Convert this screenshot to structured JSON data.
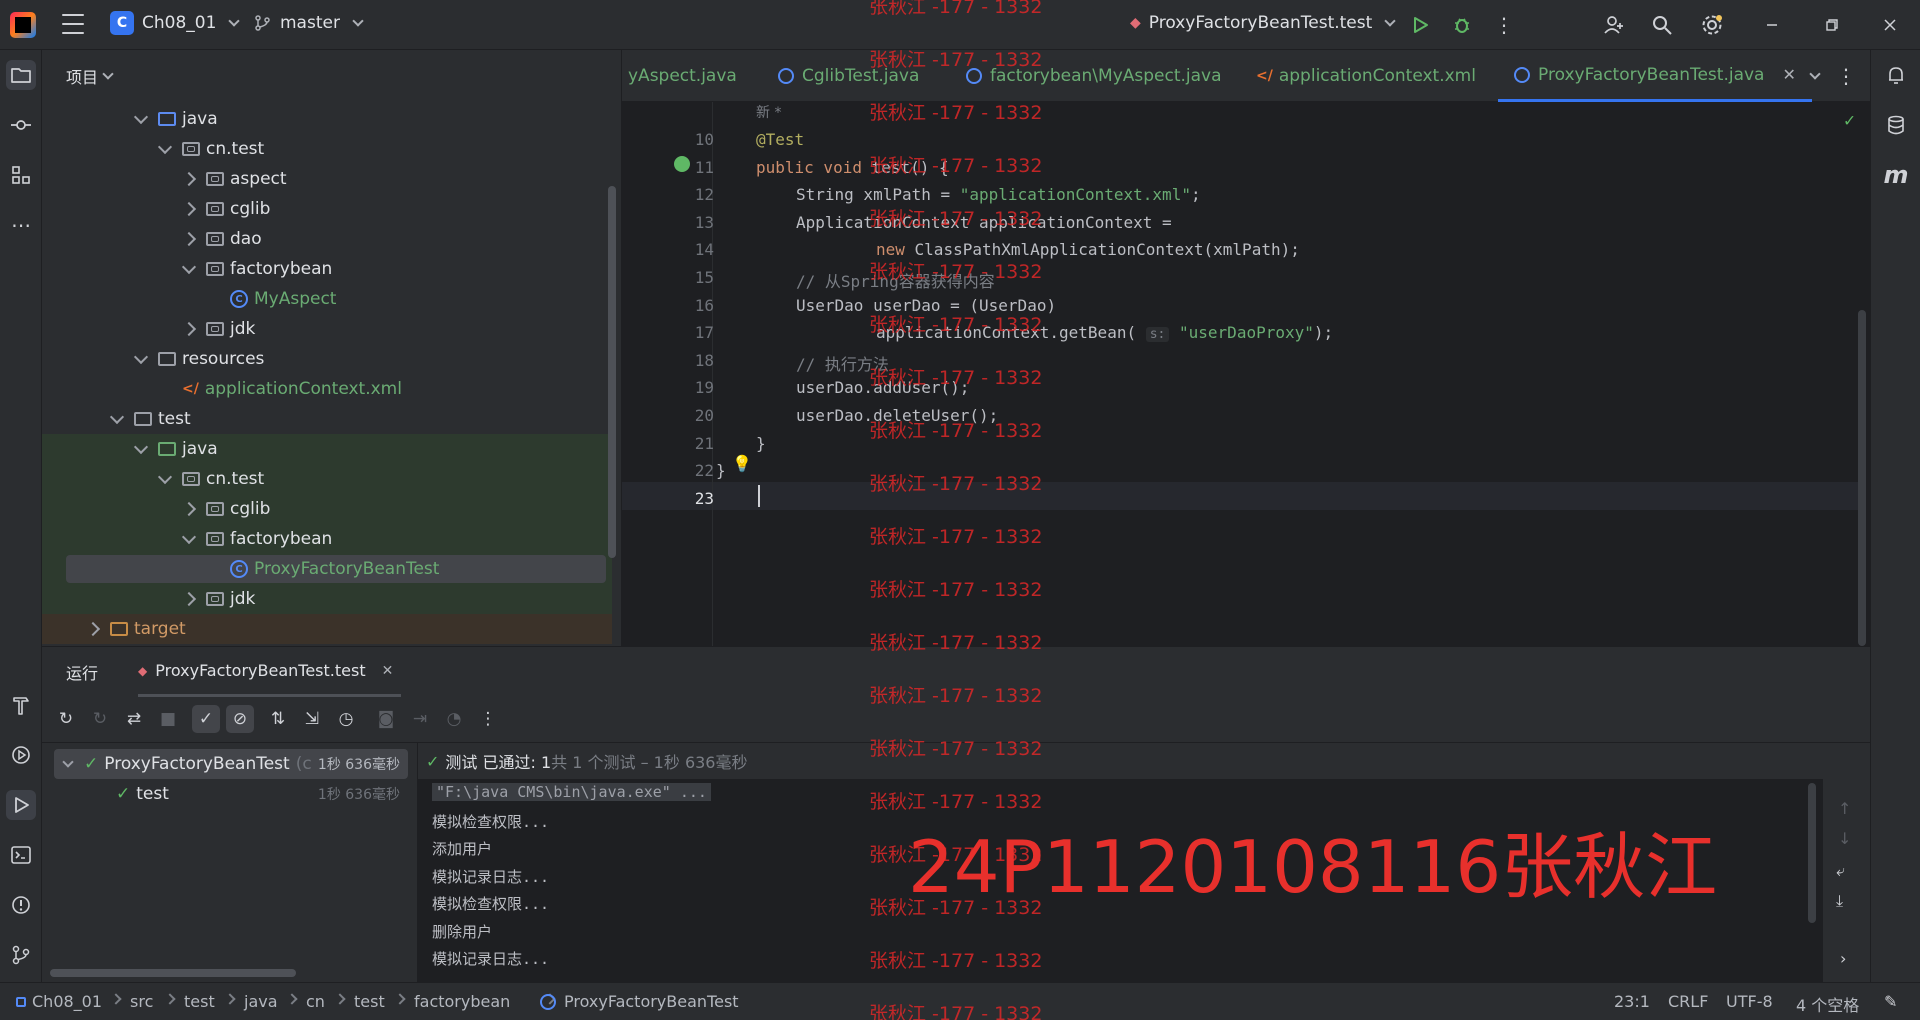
{
  "titlebar": {
    "project_badge": "C",
    "project_name": "Ch08_01",
    "branch": "master",
    "run_config": "ProxyFactoryBeanTest.test"
  },
  "project_panel": {
    "title": "项目",
    "tree": [
      {
        "label": "java",
        "indent": 3,
        "type": "folder-blue",
        "open": true
      },
      {
        "label": "cn.test",
        "indent": 4,
        "type": "package",
        "open": true
      },
      {
        "label": "aspect",
        "indent": 5,
        "type": "package",
        "open": false
      },
      {
        "label": "cglib",
        "indent": 5,
        "type": "package",
        "open": false
      },
      {
        "label": "dao",
        "indent": 5,
        "type": "package",
        "open": false
      },
      {
        "label": "factorybean",
        "indent": 5,
        "type": "package",
        "open": true
      },
      {
        "label": "MyAspect",
        "indent": 6,
        "type": "class"
      },
      {
        "label": "jdk",
        "indent": 5,
        "type": "package",
        "open": false
      },
      {
        "label": "resources",
        "indent": 3,
        "type": "folder-res",
        "open": true
      },
      {
        "label": "applicationContext.xml",
        "indent": 4,
        "type": "xml"
      },
      {
        "label": "test",
        "indent": 2,
        "type": "folder",
        "open": true
      },
      {
        "label": "java",
        "indent": 3,
        "type": "folder-green",
        "open": true
      },
      {
        "label": "cn.test",
        "indent": 4,
        "type": "package",
        "open": true
      },
      {
        "label": "cglib",
        "indent": 5,
        "type": "package",
        "open": false
      },
      {
        "label": "factorybean",
        "indent": 5,
        "type": "package",
        "open": true
      },
      {
        "label": "ProxyFactoryBeanTest",
        "indent": 6,
        "type": "class",
        "selected": true
      },
      {
        "label": "jdk",
        "indent": 5,
        "type": "package",
        "open": false
      },
      {
        "label": "target",
        "indent": 1,
        "type": "folder-orange",
        "open": false
      }
    ]
  },
  "tabs": [
    {
      "label": "yAspect.java"
    },
    {
      "label": "CglibTest.java"
    },
    {
      "label": "factorybean\\MyAspect.java"
    },
    {
      "label": "applicationContext.xml"
    },
    {
      "label": "ProxyFactoryBeanTest.java",
      "active": true
    }
  ],
  "editor": {
    "top_fragment": "新 *",
    "lines": [
      {
        "n": "10",
        "html": "<span class='ann'>@Test</span>",
        "indent": 1
      },
      {
        "n": "11",
        "html": "<span class='kw'>public void</span> test() {",
        "indent": 1
      },
      {
        "n": "12",
        "html": "String xmlPath = <span class='str'>\"applicationContext.xml\"</span>;",
        "indent": 2
      },
      {
        "n": "13",
        "html": "ApplicationContext applicationContext =",
        "indent": 2
      },
      {
        "n": "14",
        "html": "<span class='kw'>new</span> ClassPathXmlApplicationContext(xmlPath);",
        "indent": 4
      },
      {
        "n": "15",
        "html": "<span class='cmt'>// 从Spring容器获得内容</span>",
        "indent": 2
      },
      {
        "n": "16",
        "html": "UserDao userDao = (UserDao)",
        "indent": 2
      },
      {
        "n": "17",
        "html": "applicationContext.getBean( <span class='hint'>s:</span> <span class='str'>\"userDaoProxy\"</span>);",
        "indent": 4
      },
      {
        "n": "18",
        "html": "<span class='cmt'>// 执行方法</span>",
        "indent": 2
      },
      {
        "n": "19",
        "html": "userDao.addUser();",
        "indent": 2
      },
      {
        "n": "20",
        "html": "userDao.deleteUser();",
        "indent": 2
      },
      {
        "n": "21",
        "html": "}",
        "indent": 1
      },
      {
        "n": "22",
        "html": "}",
        "indent": 0
      },
      {
        "n": "23",
        "html": "",
        "indent": 0
      }
    ]
  },
  "run_panel": {
    "title": "运行",
    "tab_label": "ProxyFactoryBeanTest.test",
    "tree": [
      {
        "label": "ProxyFactoryBeanTest",
        "suffix": "(c",
        "time": "1秒 636毫秒"
      },
      {
        "label": "test",
        "time": "1秒 636毫秒"
      }
    ],
    "status_prefix": "测试 已通过: 1",
    "status_suffix": "共 1 个测试 – 1秒 636毫秒",
    "console": [
      "\"F:\\java CMS\\bin\\java.exe\" ...",
      "模拟检查权限...",
      "添加用户",
      "模拟记录日志...",
      "模拟检查权限...",
      "删除用户",
      "模拟记录日志..."
    ]
  },
  "statusbar": {
    "crumbs": [
      "Ch08_01",
      "src",
      "test",
      "java",
      "cn",
      "test",
      "factorybean",
      "ProxyFactoryBeanTest"
    ],
    "position": "23:1",
    "line_sep": "CRLF",
    "encoding": "UTF-8",
    "indent": "4 个空格"
  },
  "watermark": {
    "small": "张秋江 -177 - 1332",
    "big": "24P1120108116张秋江"
  }
}
